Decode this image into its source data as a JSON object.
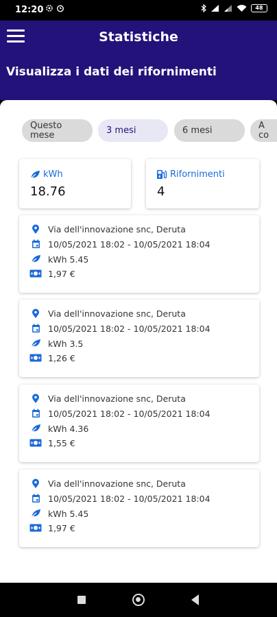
{
  "status_bar": {
    "time": "12:20",
    "battery": "48"
  },
  "app_bar": {
    "title": "Statistiche",
    "subtitle": "Visualizza i dati dei rifornimenti"
  },
  "filters": [
    {
      "label": "Questo\nmese",
      "selected": false
    },
    {
      "label": "3 mesi",
      "selected": true
    },
    {
      "label": "6 mesi",
      "selected": false
    },
    {
      "label": "A\nco",
      "selected": false
    }
  ],
  "summary": {
    "kwh": {
      "label": "kWh",
      "value": "18.76"
    },
    "refuels": {
      "label": "Rifornimenti",
      "value": "4"
    }
  },
  "refuels": [
    {
      "location": "Via dell'innovazione snc, Deruta",
      "datetime": "10/05/2021 18:02 - 10/05/2021 18:04",
      "kwh": "kWh 5.45",
      "cost": "1,97 €"
    },
    {
      "location": "Via dell'innovazione snc, Deruta",
      "datetime": "10/05/2021 18:02 - 10/05/2021 18:04",
      "kwh": "kWh 3.5",
      "cost": "1,26 €"
    },
    {
      "location": "Via dell'innovazione snc, Deruta",
      "datetime": "10/05/2021 18:02 - 10/05/2021 18:04",
      "kwh": "kWh 4.36",
      "cost": "1,55 €"
    },
    {
      "location": "Via dell'innovazione snc, Deruta",
      "datetime": "10/05/2021 18:02 - 10/05/2021 18:04",
      "kwh": "kWh 5.45",
      "cost": "1,97 €"
    }
  ],
  "colors": {
    "primary": "#22127a",
    "accent": "#1a6ad9"
  },
  "icons": {
    "menu": "hamburger-icon",
    "location": "location-pin-icon",
    "date": "calendar-icon",
    "energy": "leaf-icon",
    "cost": "cash-icon",
    "refuels": "ev-station-icon"
  }
}
